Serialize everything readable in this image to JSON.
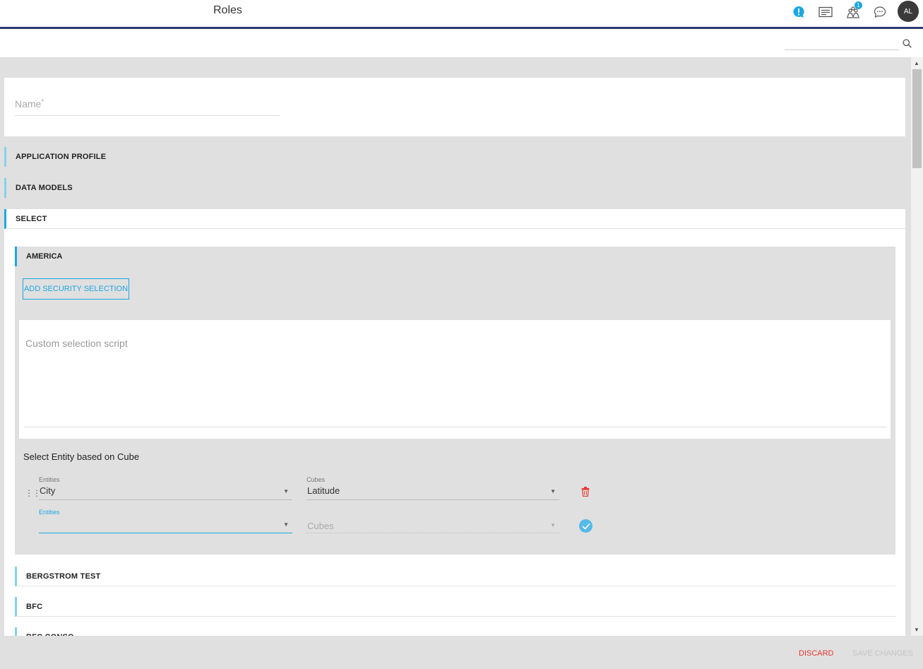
{
  "header": {
    "title": "Roles",
    "notifications_badge": "1",
    "avatar_initials": "AL"
  },
  "search": {
    "placeholder": "",
    "value": ""
  },
  "form": {
    "name_label": "Name",
    "required_marker": "*"
  },
  "sections": {
    "application_profile": "APPLICATION PROFILE",
    "data_models": "DATA MODELS",
    "select": "SELECT"
  },
  "select_panel": {
    "america": "AMERICA",
    "add_button": "ADD SECURITY SELECTION",
    "script_placeholder": "Custom selection script",
    "cube_section_title": "Select Entity based on Cube",
    "rows": [
      {
        "entities_label": "Entities",
        "entities_value": "City",
        "cubes_label": "Cubes",
        "cubes_value": "Latitude"
      },
      {
        "entities_label": "Entities",
        "entities_value": "",
        "cubes_label": "",
        "cubes_value": "Cubes"
      }
    ],
    "more_items": [
      "BERGSTROM TEST",
      "BFC",
      "BFC CONSO"
    ]
  },
  "footer": {
    "discard": "DISCARD",
    "save": "SAVE CHANGES"
  },
  "colors": {
    "accent": "#1ca7e1",
    "header_line": "#2b3a74",
    "danger": "#e53935"
  }
}
